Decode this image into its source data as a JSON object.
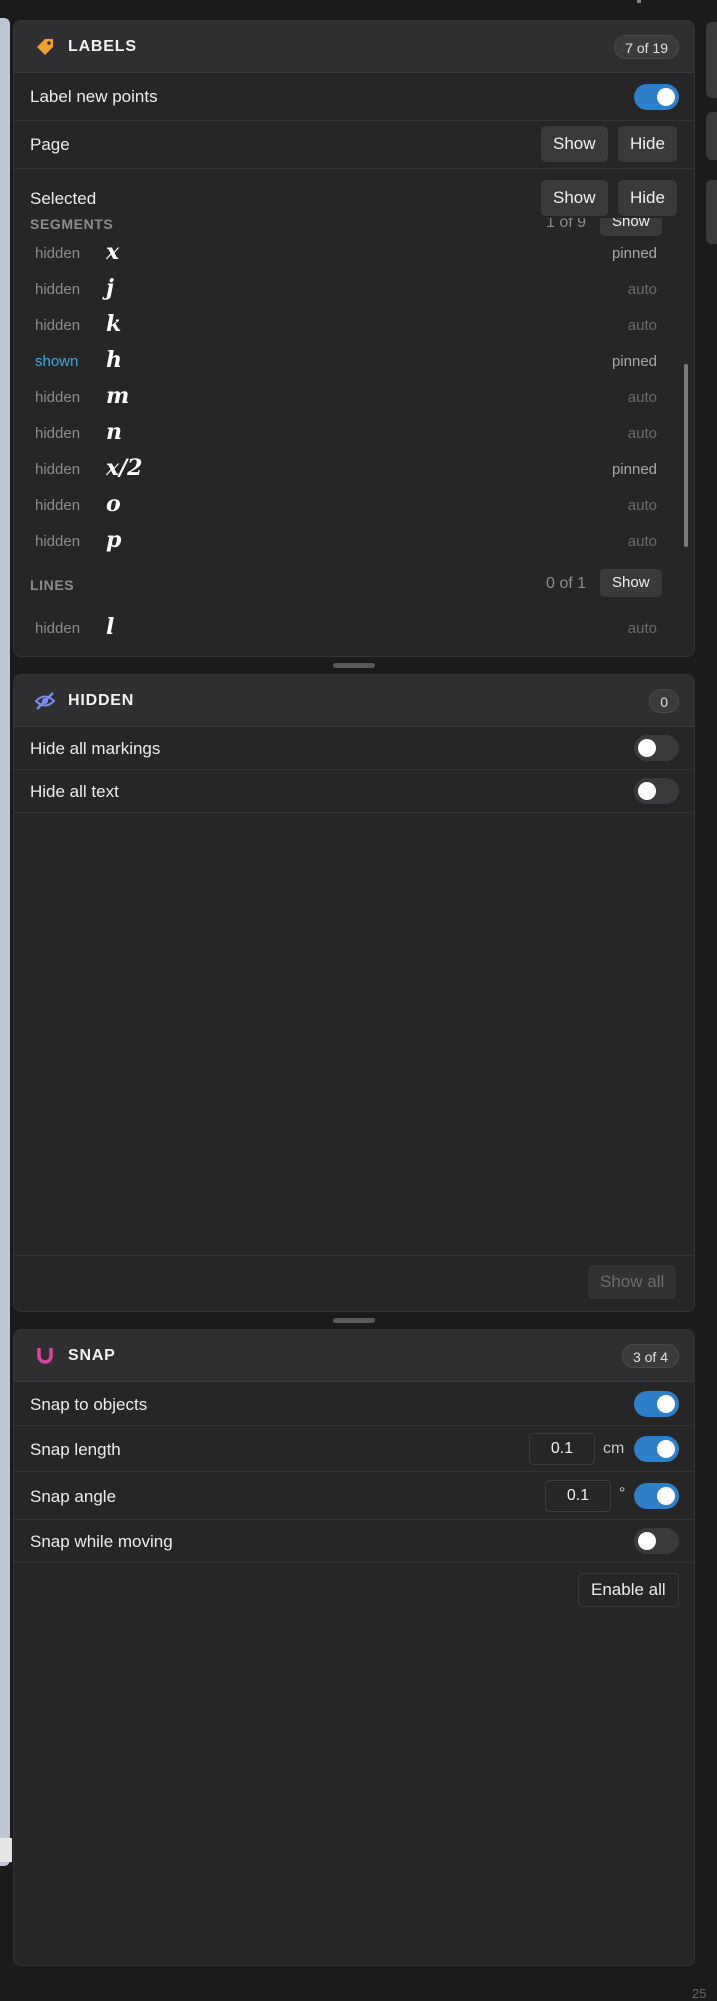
{
  "labels_panel": {
    "title": "LABELS",
    "badge": "7 of 19",
    "icon": "tag-icon",
    "label_new_points": {
      "label": "Label new points",
      "enabled": true
    },
    "page": {
      "label": "Page",
      "show": "Show",
      "hide": "Hide"
    },
    "selected": {
      "label": "Selected",
      "show": "Show",
      "hide": "Hide"
    },
    "segments": {
      "title": "SEGMENTS",
      "count": "1 of 9",
      "show": "Show",
      "items": [
        {
          "state": "hidden",
          "name": "x",
          "mode": "pinned"
        },
        {
          "state": "hidden",
          "name": "j",
          "mode": "auto"
        },
        {
          "state": "hidden",
          "name": "k",
          "mode": "auto"
        },
        {
          "state": "shown",
          "name": "h",
          "mode": "pinned"
        },
        {
          "state": "hidden",
          "name": "m",
          "mode": "auto"
        },
        {
          "state": "hidden",
          "name": "n",
          "mode": "auto"
        },
        {
          "state": "hidden",
          "name": "x/2",
          "mode": "pinned"
        },
        {
          "state": "hidden",
          "name": "o",
          "mode": "auto"
        },
        {
          "state": "hidden",
          "name": "p",
          "mode": "auto"
        }
      ]
    },
    "lines": {
      "title": "LINES",
      "count": "0 of 1",
      "show": "Show",
      "items": [
        {
          "state": "hidden",
          "name": "l",
          "mode": "auto"
        }
      ]
    }
  },
  "hidden_panel": {
    "title": "HIDDEN",
    "badge": "0",
    "icon": "eye-slash-icon",
    "hide_all_markings": {
      "label": "Hide all markings",
      "enabled": false
    },
    "hide_all_text": {
      "label": "Hide all text",
      "enabled": false
    },
    "show_all": "Show all"
  },
  "snap_panel": {
    "title": "SNAP",
    "badge": "3 of 4",
    "icon": "magnet-icon",
    "snap_to_objects": {
      "label": "Snap to objects",
      "enabled": true
    },
    "snap_length": {
      "label": "Snap length",
      "value": "0.1",
      "unit": "cm",
      "enabled": true
    },
    "snap_angle": {
      "label": "Snap angle",
      "value": "0.1",
      "unit": "°",
      "enabled": true
    },
    "snap_while_moving": {
      "label": "Snap while moving",
      "enabled": false
    },
    "enable_all": "Enable all"
  },
  "corner_text": "25",
  "colors": {
    "accent": "#2e7fc9",
    "shown": "#3aa8e8",
    "tag": "#f0a030",
    "magnet": "#e040a0",
    "eye_slash": "#7b8cf0"
  }
}
